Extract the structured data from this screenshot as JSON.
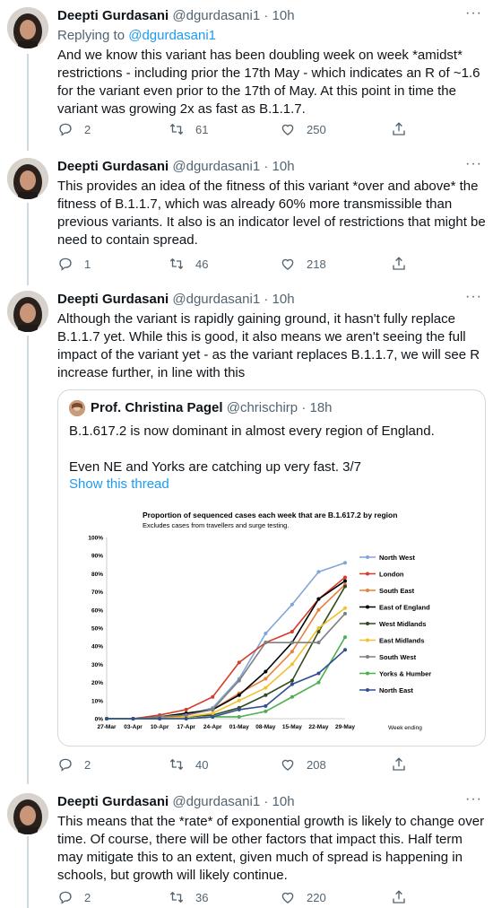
{
  "tweets": [
    {
      "name": "Deepti Gurdasani",
      "handle": "@dgurdasani1",
      "time": "10h",
      "reply_prefix": "Replying to",
      "reply_handle": "@dgurdasani1",
      "text": "And we know this variant has been doubling week on week *amidst* restrictions - including prior the 17th May - which indicates an R of ~1.6 for the variant even prior to the 17th of May. At this point in time the variant was growing 2x as fast as B.1.1.7.",
      "replies": "2",
      "retweets": "61",
      "likes": "250"
    },
    {
      "name": "Deepti Gurdasani",
      "handle": "@dgurdasani1",
      "time": "10h",
      "text": "This provides an idea of the fitness of this variant *over and above* the fitness of B.1.1.7, which was already 60% more transmissible than previous variants. It also is an indicator level of restrictions that might be need to contain spread.",
      "replies": "1",
      "retweets": "46",
      "likes": "218"
    },
    {
      "name": "Deepti Gurdasani",
      "handle": "@dgurdasani1",
      "time": "10h",
      "text": "Although the variant is rapidly gaining ground, it hasn't fully replace B.1.1.7 yet. While this is good, it also means we aren't seeing the full impact of the variant yet - as the variant replaces B.1.1.7, we will see R increase further, in line with this",
      "replies": "2",
      "retweets": "40",
      "likes": "208",
      "quote": {
        "name": "Prof. Christina Pagel",
        "handle": "@chrischirp",
        "time": "18h",
        "text_line1": "B.1.617.2 is now dominant in almost every region of England.",
        "text_line2": "Even NE and Yorks are catching up very fast. 3/7",
        "show_thread": "Show this thread"
      }
    },
    {
      "name": "Deepti Gurdasani",
      "handle": "@dgurdasani1",
      "time": "10h",
      "text": "This means that the *rate* of exponential growth is likely to change over time. Of course, there will be other factors that impact this. Half term may mitigate this to an extent, given much of spread is happening in schools, but growth will likely continue.",
      "replies": "2",
      "retweets": "36",
      "likes": "220"
    }
  ],
  "separator": "·",
  "more_glyph": "···",
  "colors": {
    "accent": "#1d9bf0",
    "secondary_text": "#536471"
  },
  "icons": [
    "reply-icon",
    "retweet-icon",
    "like-icon",
    "share-icon",
    "more-icon"
  ],
  "chart_data": {
    "type": "line",
    "title": "Proportion of sequenced cases each week that are B.1.617.2  by region",
    "subtitle": "Excludes cases from travellers and surge testing.",
    "xlabel": "Week ending",
    "ylabel": "",
    "categories": [
      "27-Mar",
      "03-Apr",
      "10-Apr",
      "17-Apr",
      "24-Apr",
      "01-May",
      "08-May",
      "15-May",
      "22-May",
      "29-May"
    ],
    "y_ticks": [
      "0%",
      "10%",
      "20%",
      "30%",
      "40%",
      "50%",
      "60%",
      "70%",
      "80%",
      "90%",
      "100%"
    ],
    "ylim": [
      0,
      100
    ],
    "legend": "right",
    "grid": false,
    "series": [
      {
        "name": "North West",
        "color": "#7ea6d8",
        "values": [
          0,
          0,
          1,
          2,
          6,
          22,
          47,
          63,
          81,
          86
        ]
      },
      {
        "name": "London",
        "color": "#d63b2c",
        "values": [
          0,
          0,
          2,
          5,
          12,
          31,
          42,
          48,
          66,
          78
        ]
      },
      {
        "name": "South East",
        "color": "#e6823a",
        "values": [
          0,
          0,
          0,
          2,
          5,
          14,
          22,
          37,
          60,
          74
        ]
      },
      {
        "name": "East of England",
        "color": "#000000",
        "values": [
          0,
          0,
          1,
          3,
          5,
          13,
          26,
          42,
          66,
          76
        ]
      },
      {
        "name": "West Midlands",
        "color": "#2f4a1f",
        "values": [
          0,
          0,
          0,
          1,
          2,
          6,
          13,
          21,
          48,
          73
        ]
      },
      {
        "name": "East Midlands",
        "color": "#f2c12e",
        "values": [
          0,
          0,
          0,
          1,
          3,
          10,
          17,
          30,
          50,
          61
        ]
      },
      {
        "name": "South West",
        "color": "#7f7f7f",
        "values": [
          0,
          0,
          1,
          2,
          5,
          21,
          42,
          42,
          42,
          58
        ]
      },
      {
        "name": "Yorks & Humber",
        "color": "#4caf50",
        "values": [
          0,
          0,
          0,
          0,
          1,
          1,
          4,
          12,
          20,
          45
        ]
      },
      {
        "name": "North East",
        "color": "#2f4f8f",
        "values": [
          0,
          0,
          0,
          0,
          1,
          5,
          7,
          19,
          25,
          38
        ]
      }
    ]
  }
}
